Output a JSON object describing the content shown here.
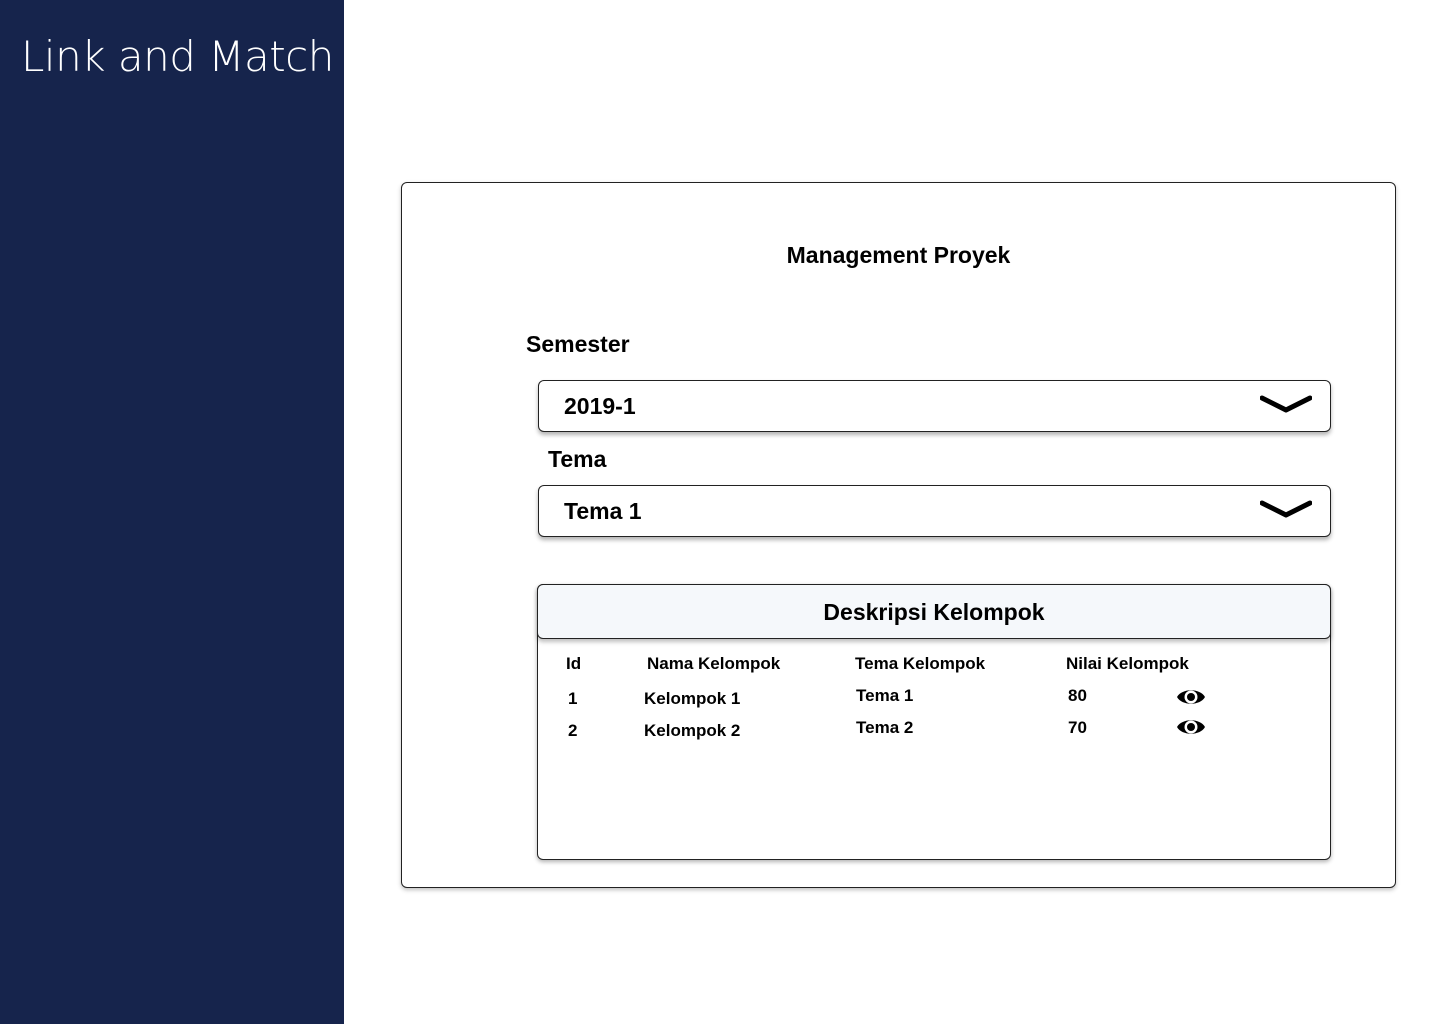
{
  "app": {
    "title": "Link and Match"
  },
  "page": {
    "title": "Management Proyek"
  },
  "filters": {
    "semester": {
      "label": "Semester",
      "value": "2019-1"
    },
    "tema": {
      "label": "Tema",
      "value": "Tema 1"
    }
  },
  "groups": {
    "title": "Deskripsi Kelompok",
    "columns": {
      "id": "Id",
      "name": "Nama Kelompok",
      "theme": "Tema Kelompok",
      "score": "Nilai Kelompok"
    },
    "rows": [
      {
        "id": "1",
        "name": "Kelompok 1",
        "theme": "Tema 1",
        "score": "80",
        "action_icon": "eye-icon"
      },
      {
        "id": "2",
        "name": "Kelompok 2",
        "theme": "Tema 2",
        "score": "70",
        "action_icon": "eye-icon"
      }
    ]
  },
  "colors": {
    "sidebar": "#16244c",
    "table_header": "#f5f8fb"
  }
}
